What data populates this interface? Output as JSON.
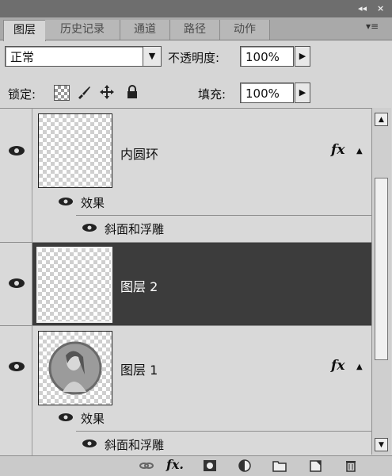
{
  "panel": {
    "title_controls": {
      "collapse": "◂◂",
      "close": "×"
    },
    "tabs": [
      {
        "label": "图层",
        "active": true
      },
      {
        "label": "历史记录",
        "active": false
      },
      {
        "label": "通道",
        "active": false
      },
      {
        "label": "路径",
        "active": false
      },
      {
        "label": "动作",
        "active": false
      }
    ],
    "menu_glyph": "▾≡"
  },
  "blend": {
    "mode": "正常",
    "opacity_label": "不透明度:",
    "opacity_value": "100%"
  },
  "lock": {
    "label": "锁定:",
    "fill_label": "填充:",
    "fill_value": "100%"
  },
  "layers": [
    {
      "name": "内圆环",
      "visible": true,
      "has_fx": true,
      "selected": false,
      "effects_label": "效果",
      "effect_items": [
        "斜面和浮雕"
      ]
    },
    {
      "name": "图层 2",
      "visible": true,
      "has_fx": false,
      "selected": true
    },
    {
      "name": "图层 1",
      "visible": true,
      "has_fx": true,
      "selected": false,
      "effects_label": "效果",
      "effect_items": [
        "斜面和浮雕"
      ]
    }
  ],
  "bottom_toolbar": {
    "icons": [
      "link-icon",
      "fx-icon",
      "mask-icon",
      "adjustment-icon",
      "group-folder-icon",
      "new-layer-icon",
      "trash-icon"
    ],
    "fx_text": "fx."
  },
  "colors": {
    "selected_row": "#3c3c3c",
    "panel_bg": "#d6d6d6"
  }
}
